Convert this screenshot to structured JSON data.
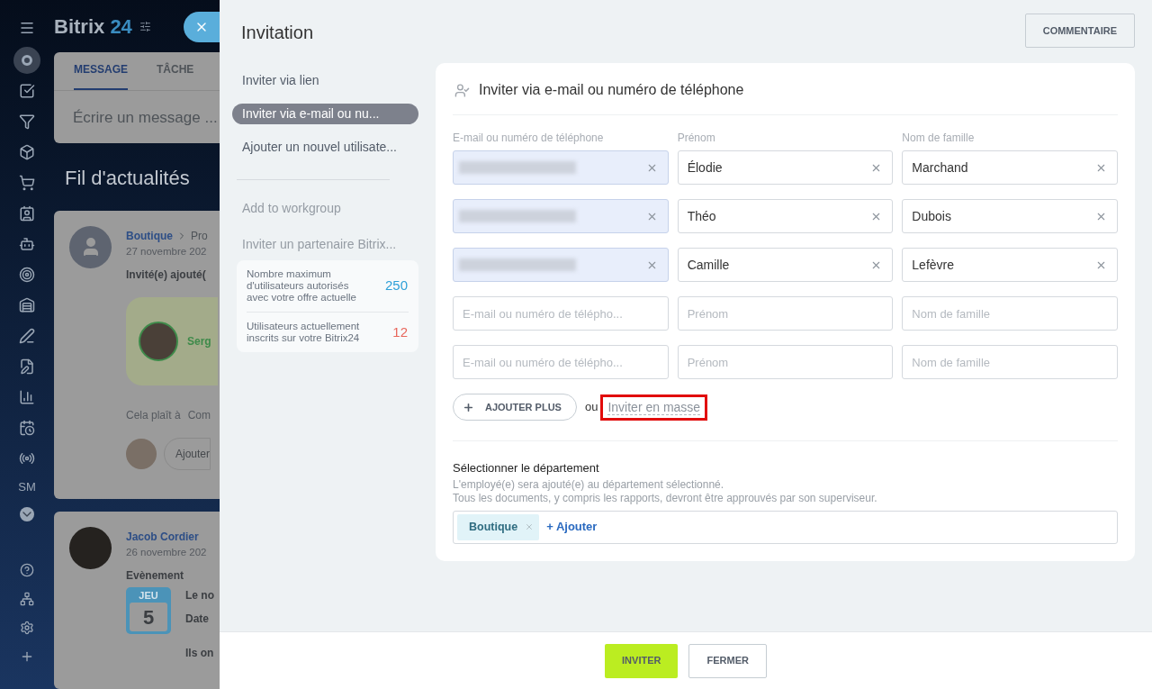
{
  "background": {
    "brand": "Bitrix",
    "brand_number": "24",
    "sidebar": {
      "monogram": "SM"
    },
    "composer": {
      "tabs": [
        {
          "label": "MESSAGE",
          "selected": true
        },
        {
          "label": "TÂCHE",
          "selected": false
        }
      ],
      "placeholder": "Écrire un message ..."
    },
    "feed_title": "Fil d'actualités",
    "posts": [
      {
        "kind": "guest",
        "author": "Boutique",
        "breadcrumb": "Pro",
        "date": "27 novembre 202",
        "headline": "Invité(e) ajouté(",
        "guest": "Serg",
        "like": "Cela plaît à",
        "comment": "Com",
        "comment_placeholder": "Ajouter"
      },
      {
        "kind": "event",
        "author": "Jacob Cordier",
        "date": "26 novembre 202",
        "headline": "Evènement",
        "day_name": "JEU",
        "day": "5",
        "lines": [
          "Le no",
          "Date",
          "Ils on"
        ]
      }
    ]
  },
  "panel": {
    "title": "Invitation",
    "comment_button": "COMMENTAIRE",
    "nav": {
      "items": [
        {
          "label": "Inviter via lien",
          "selected": false
        },
        {
          "label": "Inviter via e-mail ou nu...",
          "selected": true
        },
        {
          "label": "Ajouter un nouvel utilisate...",
          "selected": false
        }
      ],
      "extra_items": [
        {
          "label": "Add to workgroup",
          "selected": false
        },
        {
          "label": "Inviter un partenaire Bitrix...",
          "selected": false
        }
      ]
    },
    "limits": [
      {
        "label": "Nombre maximum d'utilisateurs autorisés avec votre offre actuelle",
        "value": "250",
        "color": "#2fa0d8"
      },
      {
        "label": "Utilisateurs actuellement inscrits sur votre Bitrix24",
        "value": "12",
        "color": "#e8675c"
      }
    ],
    "form": {
      "title": "Inviter via e-mail ou numéro de téléphone",
      "columns": [
        "E-mail ou numéro de téléphone",
        "Prénom",
        "Nom de famille"
      ],
      "rows": [
        {
          "cells": [
            {
              "kind": "redacted"
            },
            {
              "kind": "value",
              "value": "Élodie"
            },
            {
              "kind": "value",
              "value": "Marchand"
            }
          ]
        },
        {
          "cells": [
            {
              "kind": "redacted"
            },
            {
              "kind": "value",
              "value": "Théo"
            },
            {
              "kind": "value",
              "value": "Dubois"
            }
          ]
        },
        {
          "cells": [
            {
              "kind": "redacted"
            },
            {
              "kind": "value",
              "value": "Camille"
            },
            {
              "kind": "value",
              "value": "Lefèvre"
            }
          ]
        },
        {
          "cells": [
            {
              "kind": "empty",
              "placeholder": "E-mail ou numéro de télépho..."
            },
            {
              "kind": "empty",
              "placeholder": "Prénom"
            },
            {
              "kind": "empty",
              "placeholder": "Nom de famille"
            }
          ]
        },
        {
          "cells": [
            {
              "kind": "empty",
              "placeholder": "E-mail ou numéro de télépho..."
            },
            {
              "kind": "empty",
              "placeholder": "Prénom"
            },
            {
              "kind": "empty",
              "placeholder": "Nom de famille"
            }
          ]
        }
      ],
      "add_more": "AJOUTER PLUS",
      "or": "ou",
      "mass_invite": {
        "label": "Inviter en masse",
        "highlighted": true
      }
    },
    "department": {
      "title": "Sélectionner le département",
      "hint": "L'employé(e) sera ajouté(e) au département sélectionné.",
      "hint_2": "Tous les documents, y compris les rapports, devront être approuvés par son superviseur.",
      "tags": [
        "Boutique"
      ],
      "add": "+ Ajouter"
    },
    "footer": {
      "buttons": [
        {
          "label": "INVITER",
          "kind": "primary"
        },
        {
          "label": "FERMER",
          "kind": "secondary"
        }
      ]
    }
  }
}
